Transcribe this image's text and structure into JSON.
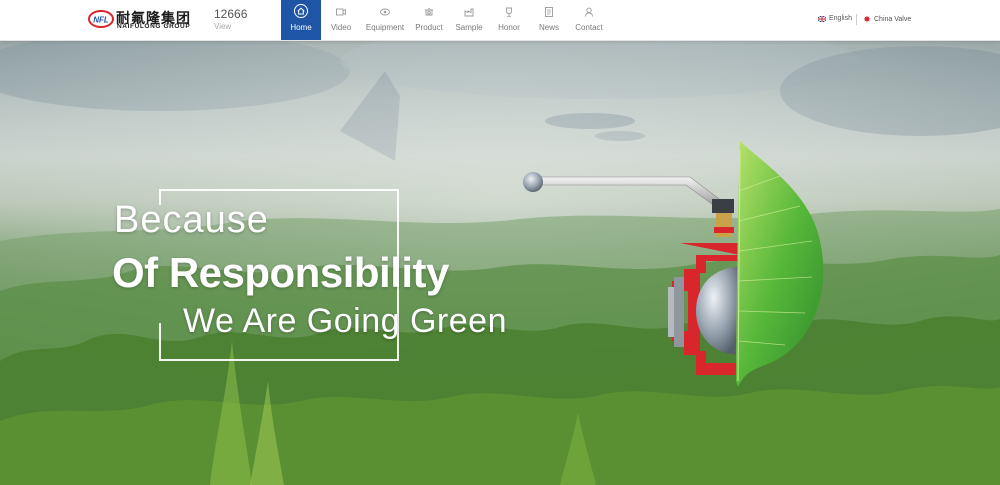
{
  "brand": {
    "logo_mark": "NFL",
    "name_cn": "耐氟隆集团",
    "name_en": "NAIFULONG GROUP"
  },
  "view_counter": {
    "count": "12666",
    "label": "View"
  },
  "nav": {
    "active_color": "#1e55a6",
    "items": [
      {
        "label": "Home",
        "icon": "home-icon",
        "active": true
      },
      {
        "label": "Video",
        "icon": "video-icon"
      },
      {
        "label": "Equipment",
        "icon": "equipment-icon"
      },
      {
        "label": "Product",
        "icon": "product-icon"
      },
      {
        "label": "Sample",
        "icon": "sample-icon"
      },
      {
        "label": "Honor",
        "icon": "trophy-icon"
      },
      {
        "label": "News",
        "icon": "news-icon"
      },
      {
        "label": "Contact",
        "icon": "contact-icon"
      }
    ]
  },
  "language": {
    "english": "English",
    "china_valve": "China Valve"
  },
  "hero": {
    "line1": "Because",
    "line2": "Of Responsibility",
    "line3": "We Are Going Green"
  }
}
